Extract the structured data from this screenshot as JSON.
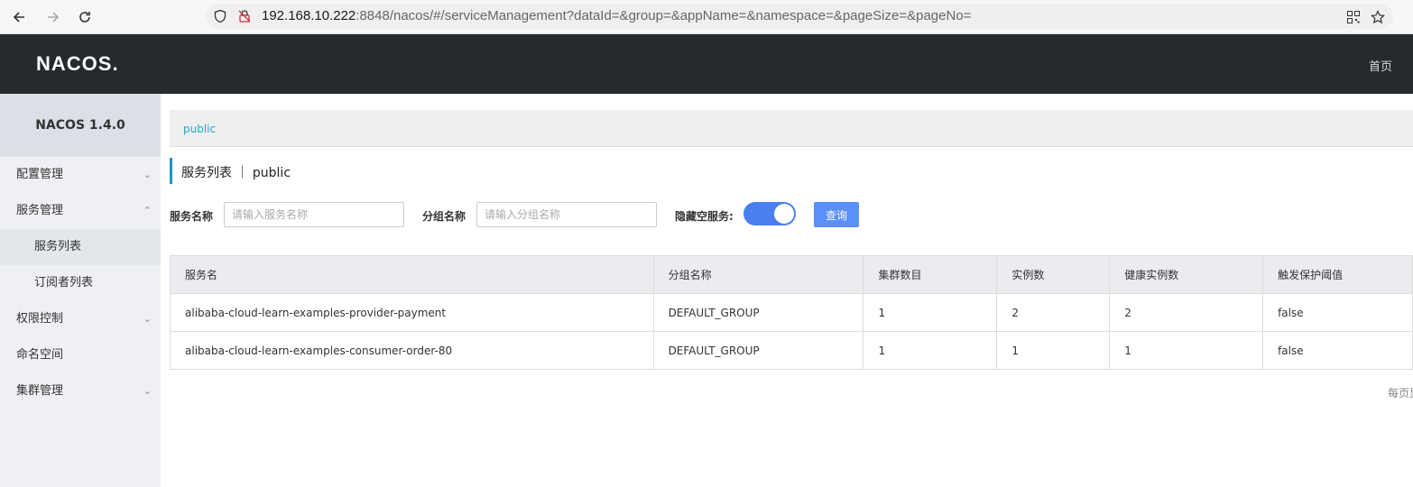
{
  "browser": {
    "url_host": "192.168.10.222",
    "url_rest": ":8848/nacos/#/serviceManagement?dataId=&group=&appName=&namespace=&pageSize=&pageNo="
  },
  "header": {
    "logo": "NACOS",
    "logo_dot": ".",
    "home": "首页"
  },
  "sidebar": {
    "title": "NACOS 1.4.0",
    "items": [
      {
        "label": "配置管理"
      },
      {
        "label": "服务管理"
      },
      {
        "label": "服务列表"
      },
      {
        "label": "订阅者列表"
      },
      {
        "label": "权限控制"
      },
      {
        "label": "命名空间"
      },
      {
        "label": "集群管理"
      }
    ]
  },
  "breadcrumb": {
    "namespace": "public"
  },
  "page": {
    "title": "服务列表 ｜ public"
  },
  "filters": {
    "service_label": "服务名称",
    "service_placeholder": "请输入服务名称",
    "group_label": "分组名称",
    "group_placeholder": "请输入分组名称",
    "hide_empty_label": "隐藏空服务:",
    "query": "查询"
  },
  "table": {
    "headers": [
      "服务名",
      "分组名称",
      "集群数目",
      "实例数",
      "健康实例数",
      "触发保护阈值"
    ],
    "rows": [
      [
        "alibaba-cloud-learn-examples-provider-payment",
        "DEFAULT_GROUP",
        "1",
        "2",
        "2",
        "false"
      ],
      [
        "alibaba-cloud-learn-examples-consumer-order-80",
        "DEFAULT_GROUP",
        "1",
        "1",
        "1",
        "false"
      ]
    ]
  },
  "pager": {
    "label": "每页显"
  }
}
